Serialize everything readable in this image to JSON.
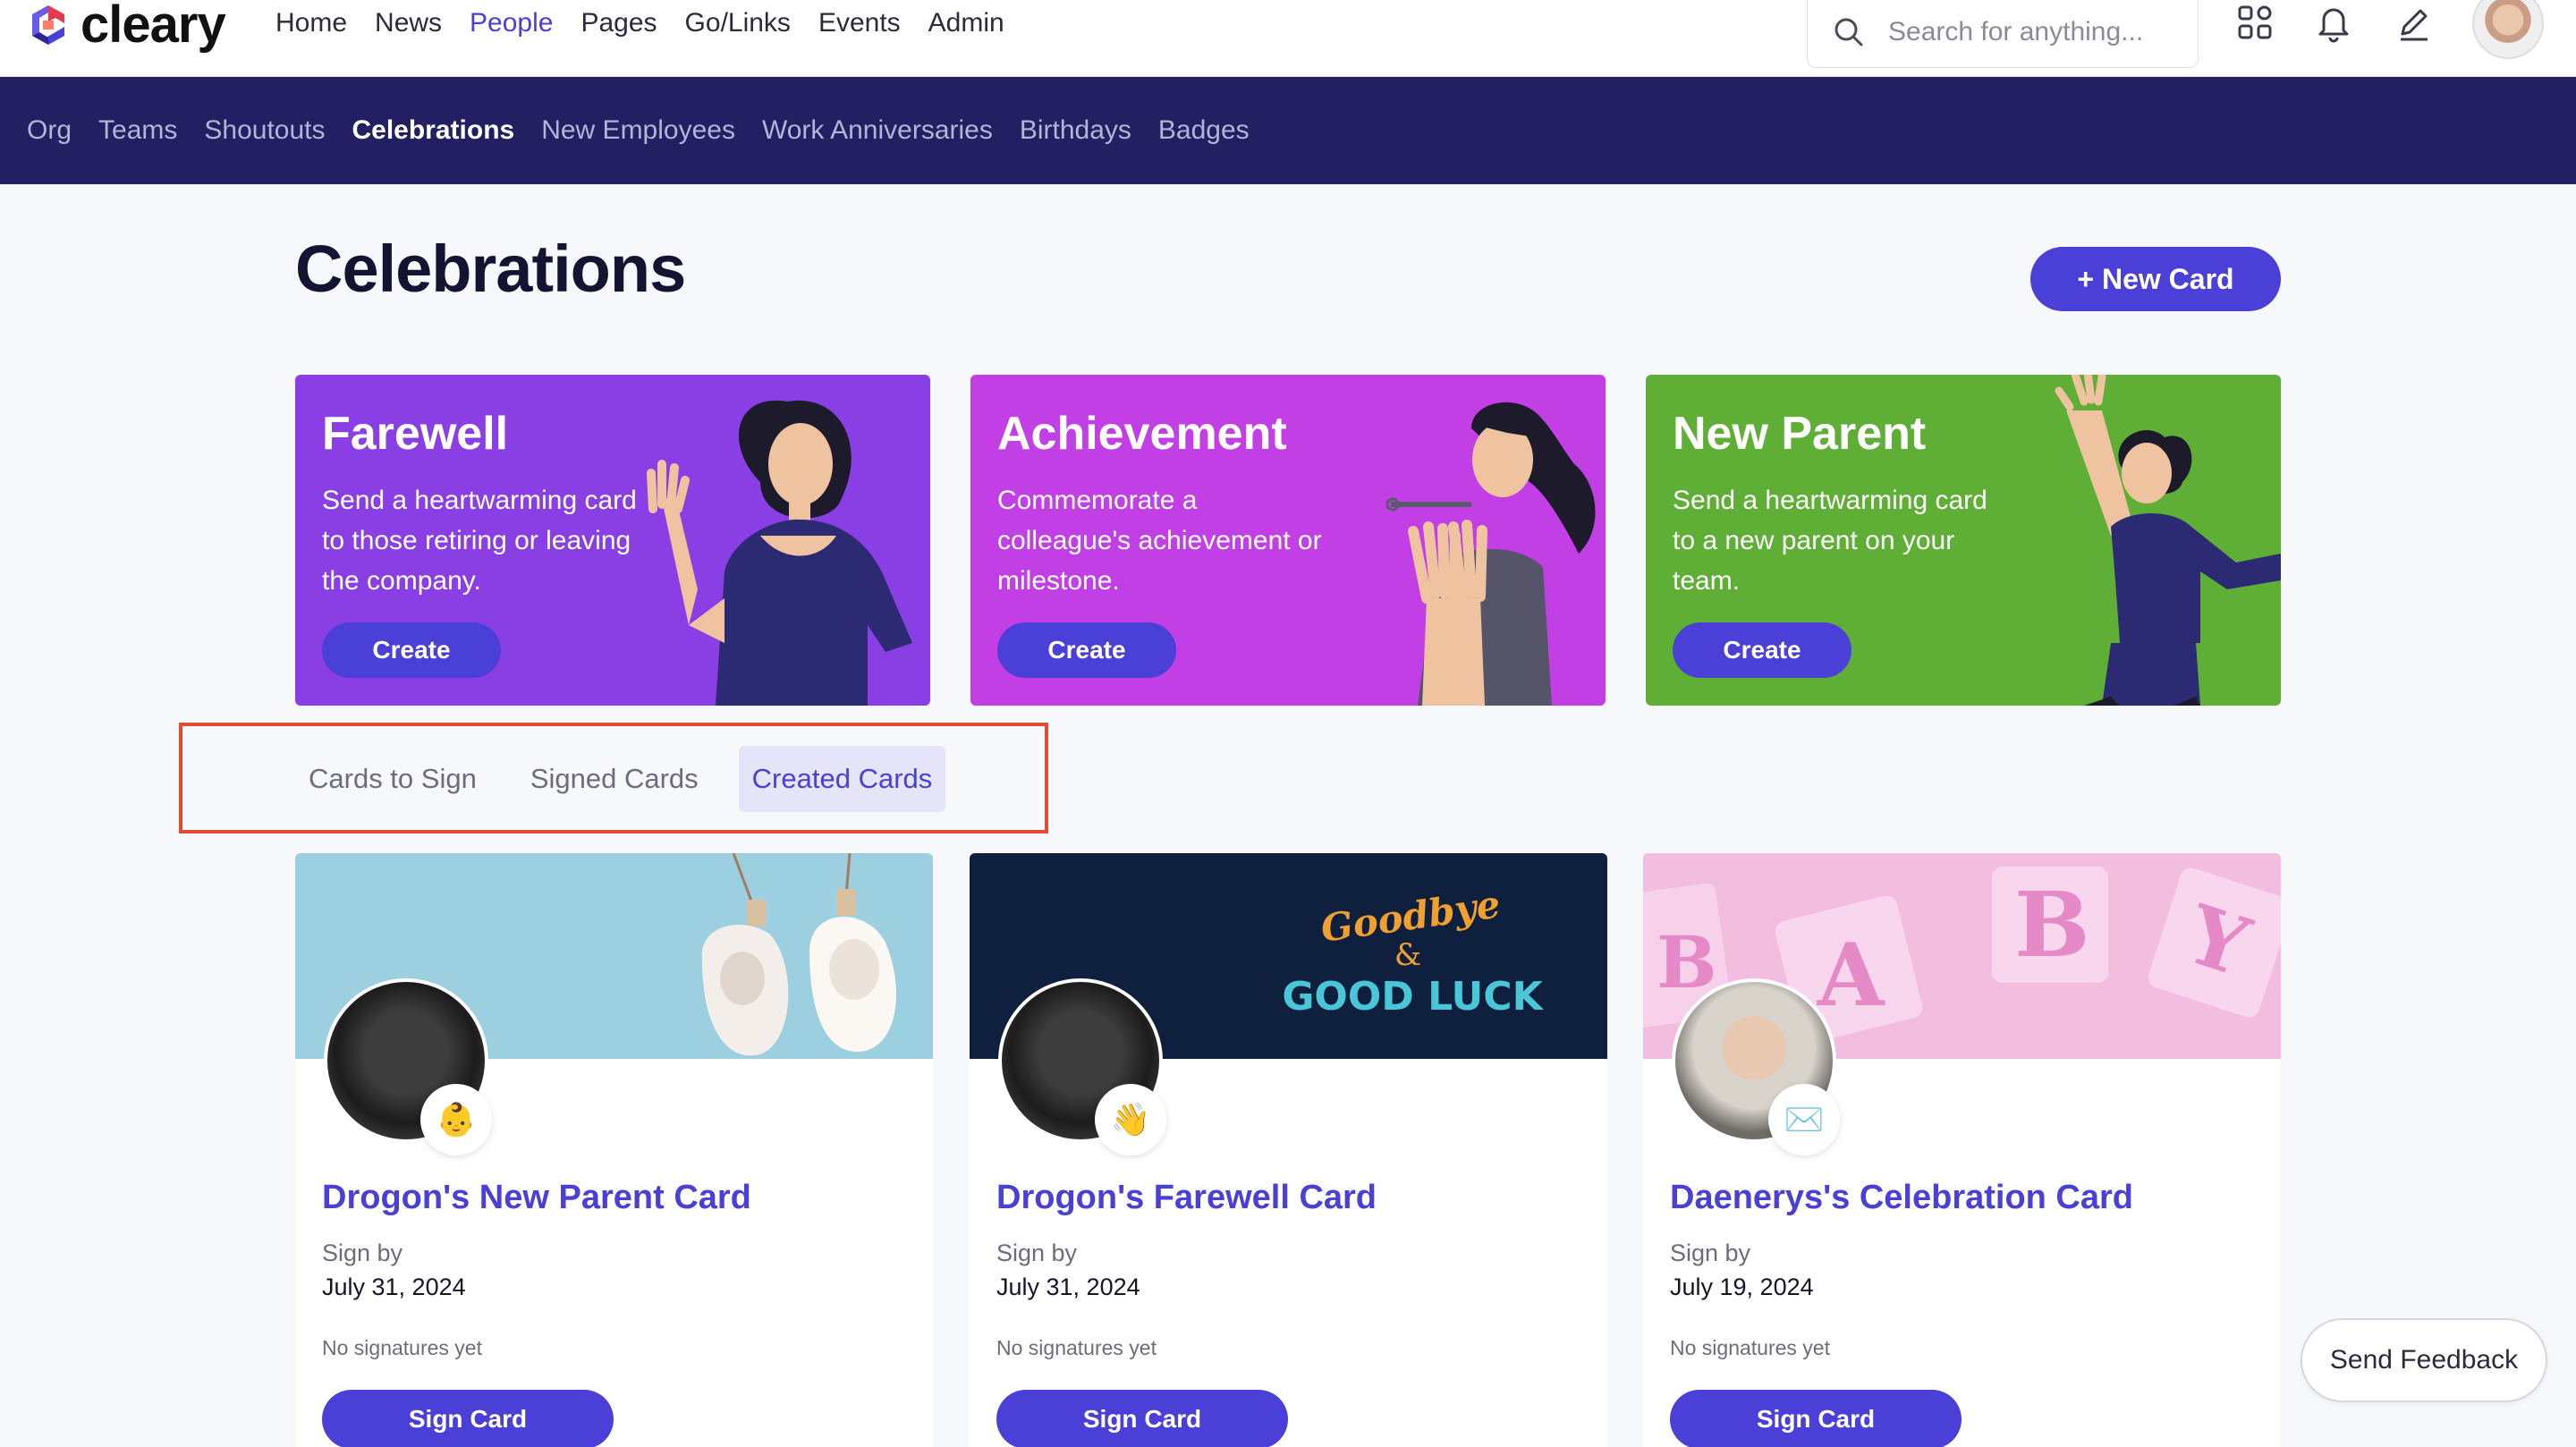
{
  "brand": {
    "name": "cleary",
    "accent": "#4a3fd6",
    "nav_bg": "#221f63"
  },
  "topnav": {
    "items": [
      {
        "label": "Home",
        "active": false
      },
      {
        "label": "News",
        "active": false
      },
      {
        "label": "People",
        "active": true
      },
      {
        "label": "Pages",
        "active": false
      },
      {
        "label": "Go/Links",
        "active": false
      },
      {
        "label": "Events",
        "active": false
      },
      {
        "label": "Admin",
        "active": false
      }
    ],
    "search_placeholder": "Search for anything...",
    "icons": [
      "search-icon",
      "apps-grid-icon",
      "bell-icon",
      "pencil-icon",
      "user-avatar"
    ]
  },
  "subnav": {
    "items": [
      {
        "label": "Org",
        "active": false
      },
      {
        "label": "Teams",
        "active": false
      },
      {
        "label": "Shoutouts",
        "active": false
      },
      {
        "label": "Celebrations",
        "active": true
      },
      {
        "label": "New Employees",
        "active": false
      },
      {
        "label": "Work Anniversaries",
        "active": false
      },
      {
        "label": "Birthdays",
        "active": false
      },
      {
        "label": "Badges",
        "active": false
      }
    ]
  },
  "page": {
    "title": "Celebrations",
    "new_card_label": "+ New Card"
  },
  "templates": [
    {
      "title": "Farewell",
      "description": "Send a heartwarming card to those retiring or leaving the company.",
      "button": "Create",
      "color": "#8a3fe4"
    },
    {
      "title": "Achievement",
      "description": "Commemorate a colleague's achievement or milestone.",
      "button": "Create",
      "color": "#c23fe6"
    },
    {
      "title": "New Parent",
      "description": "Send a heartwarming card to a new parent on your team.",
      "button": "Create",
      "color": "#5fae36"
    }
  ],
  "tabs": [
    {
      "label": "Cards to Sign",
      "active": false
    },
    {
      "label": "Signed Cards",
      "active": false
    },
    {
      "label": "Created Cards",
      "active": true
    }
  ],
  "cards": [
    {
      "title": "Drogon's New Parent Card",
      "sign_by_label": "Sign by",
      "date": "July 31, 2024",
      "signatures": "No signatures yet",
      "button": "Sign Card",
      "emoji": "👶",
      "banner": "baby-shoes"
    },
    {
      "title": "Drogon's Farewell Card",
      "sign_by_label": "Sign by",
      "date": "July 31, 2024",
      "signatures": "No signatures yet",
      "button": "Sign Card",
      "emoji": "👋",
      "banner": "goodbye-good-luck"
    },
    {
      "title": "Daenerys's Celebration Card",
      "sign_by_label": "Sign by",
      "date": "July 19, 2024",
      "signatures": "No signatures yet",
      "button": "Sign Card",
      "emoji": "✉️",
      "banner": "baby-blocks"
    }
  ],
  "banner_text": {
    "goodbye": "Goodbye",
    "amp": "&",
    "good_luck": "GOOD LUCK"
  },
  "feedback_label": "Send Feedback"
}
